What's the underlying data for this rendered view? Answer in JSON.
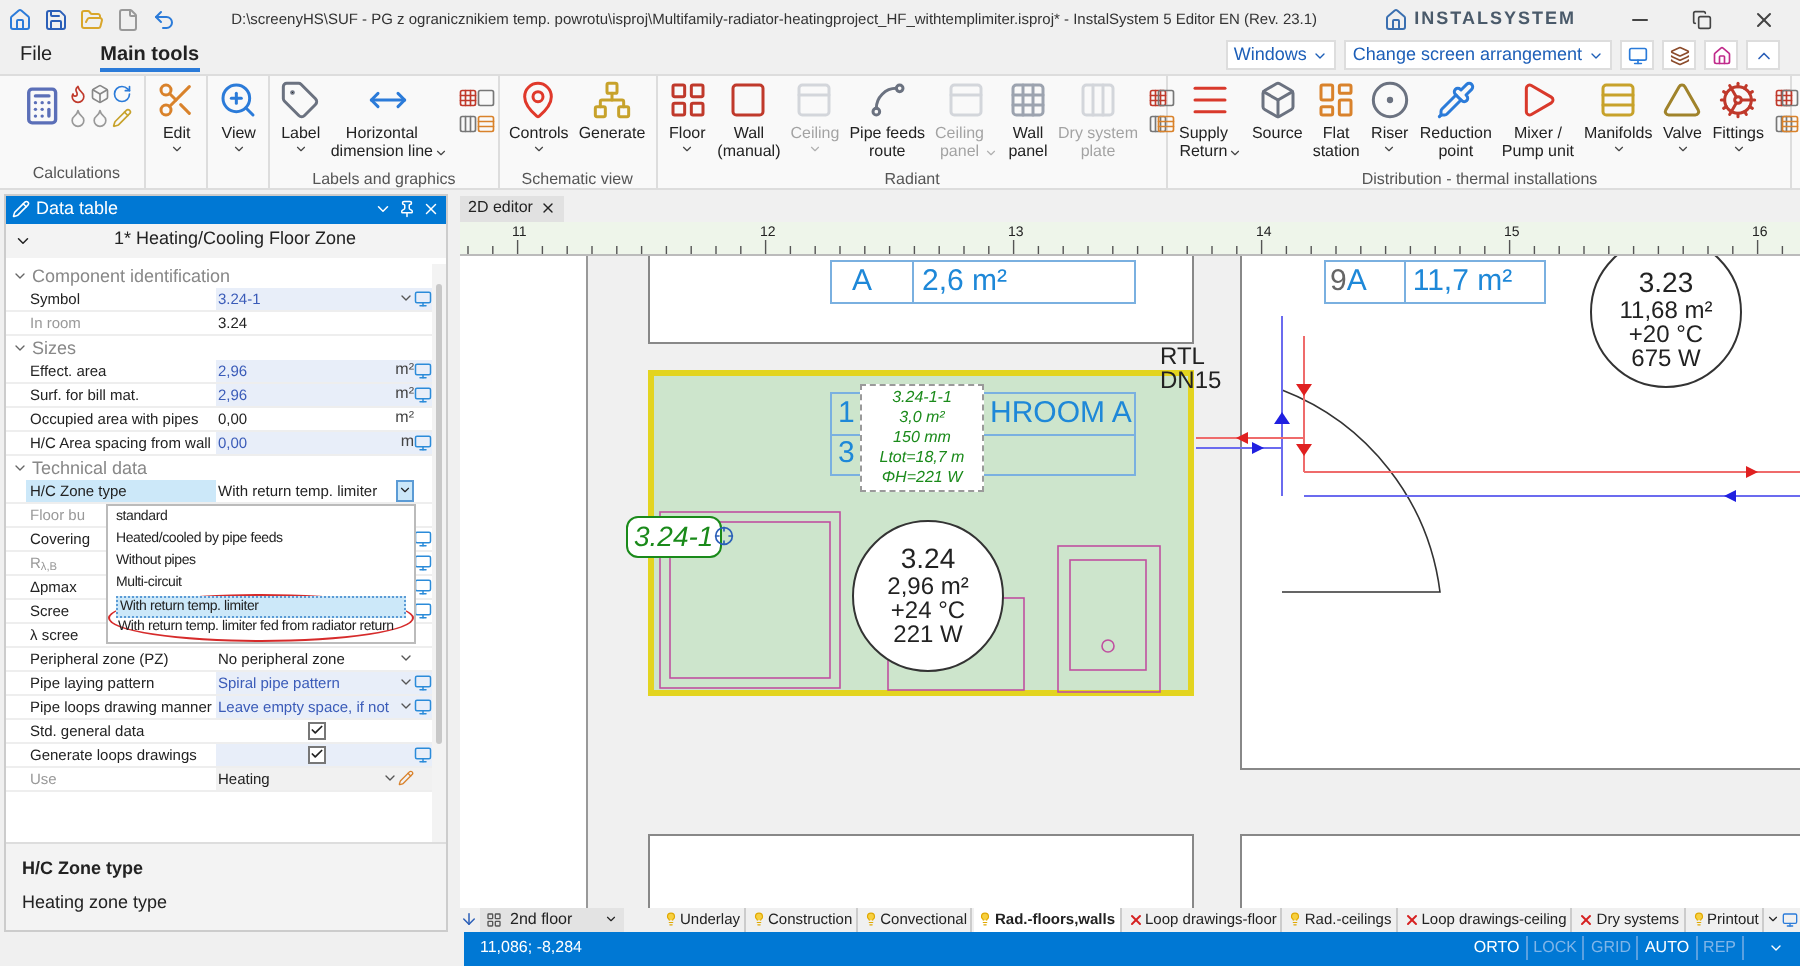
{
  "window": {
    "title": "D:\\screenyHS\\SUF - PG z ogranicznikiem temp. powrotu\\isproj\\Multifamily-radiator-heatingproject_HF_withtemplimiter.isproj* - InstalSystem 5 Editor EN (Rev. 23.1)",
    "logo": "INSTALSYSTEM"
  },
  "menu_tabs": [
    {
      "label": "File",
      "selected": false
    },
    {
      "label": "Main tools",
      "selected": true
    }
  ],
  "top_right": {
    "windows": "Windows",
    "arrangement": "Change screen arrangement"
  },
  "ribbon": [
    {
      "label": "Calculations"
    },
    {
      "buttons": [
        {
          "label": "Edit",
          "dropdown": true,
          "disabled": false
        }
      ]
    },
    {
      "buttons": [
        {
          "label": "View",
          "dropdown": true,
          "disabled": false
        }
      ]
    },
    {
      "label": "Labels and graphics",
      "buttons": [
        {
          "label": "Label",
          "dropdown": true,
          "disabled": false
        },
        {
          "label": "Horizontal\ndimension line",
          "dropdown": true,
          "disabled": false
        }
      ],
      "side_tools": true
    },
    {
      "label": "Schematic view",
      "buttons": [
        {
          "label": "Controls",
          "dropdown": true,
          "disabled": false
        },
        {
          "label": "Generate",
          "dropdown": false,
          "disabled": false
        }
      ]
    },
    {
      "label": "Radiant",
      "buttons": [
        {
          "label": "Floor",
          "dropdown": true,
          "disabled": false
        },
        {
          "label": "Wall\n(manual)",
          "dropdown": false,
          "disabled": false
        },
        {
          "label": "Ceiling",
          "dropdown": true,
          "disabled": true
        },
        {
          "label": "Pipe feeds\nroute",
          "dropdown": false,
          "disabled": false
        },
        {
          "label": "Ceiling\npanel",
          "dropdown": true,
          "disabled": true
        },
        {
          "label": "Wall\npanel",
          "dropdown": false,
          "disabled": false
        },
        {
          "label": "Dry system\nplate",
          "dropdown": false,
          "disabled": true
        }
      ],
      "side_tools": true
    },
    {
      "label": "Distribution - thermal installations",
      "buttons": [
        {
          "label": "Supply\nReturn",
          "dropdown": true,
          "disabled": false
        },
        {
          "label": "Source",
          "dropdown": false,
          "disabled": false
        },
        {
          "label": "Flat\nstation",
          "dropdown": false,
          "disabled": false
        },
        {
          "label": "Riser",
          "dropdown": true,
          "disabled": false
        },
        {
          "label": "Reduction\npoint",
          "dropdown": false,
          "disabled": false
        },
        {
          "label": "Mixer /\nPump unit",
          "dropdown": false,
          "disabled": false
        },
        {
          "label": "Manifolds",
          "dropdown": true,
          "disabled": false
        },
        {
          "label": "Valve",
          "dropdown": true,
          "disabled": false
        },
        {
          "label": "Fittings",
          "dropdown": true,
          "disabled": false
        }
      ],
      "side_tools": true
    }
  ],
  "data_table": {
    "title": "Data table",
    "subject": "1* Heating/Cooling Floor Zone",
    "rows": [
      {
        "kind": "section",
        "label": "Component identification"
      },
      {
        "kind": "property",
        "label": "Symbol",
        "value": "3.24-1",
        "disabled": false,
        "highlighted": true,
        "dropdown": true,
        "link": true,
        "selected": false
      },
      {
        "kind": "property",
        "label": "In room",
        "value": "3.24",
        "disabled": true,
        "highlighted": false,
        "dropdown": false,
        "link": false,
        "selected": false
      },
      {
        "kind": "section",
        "label": "Sizes"
      },
      {
        "kind": "property",
        "label": "Effect. area",
        "value": "2,96",
        "unit": "m²",
        "disabled": false,
        "highlighted": true,
        "dropdown": false,
        "link": true,
        "selected": false
      },
      {
        "kind": "property",
        "label": "Surf. for bill mat.",
        "value": "2,96",
        "unit": "m²",
        "disabled": false,
        "highlighted": true,
        "dropdown": false,
        "link": true,
        "selected": false
      },
      {
        "kind": "property",
        "label": "Occupied area with pipes",
        "value": "0,00",
        "unit": "m²",
        "disabled": false,
        "highlighted": false,
        "dropdown": false,
        "link": false,
        "selected": false
      },
      {
        "kind": "property",
        "label": "H/C Area spacing from wall",
        "value": "0,00",
        "unit": "m",
        "disabled": false,
        "highlighted": true,
        "dropdown": false,
        "link": true,
        "selected": false
      },
      {
        "kind": "section",
        "label": "Technical data"
      },
      {
        "kind": "property",
        "label": "H/C Zone type",
        "value": "With return temp. limiter",
        "disabled": false,
        "highlighted": false,
        "dropdown": true,
        "link": false,
        "selected": true
      },
      {
        "kind": "property",
        "label": "Floor bu",
        "disabled": true,
        "highlighted": false,
        "dropdown": false,
        "link": false,
        "selected": false
      },
      {
        "kind": "property",
        "label": "Covering",
        "disabled": false,
        "highlighted": false,
        "dropdown": false,
        "link": true,
        "selected": false
      },
      {
        "kind": "property",
        "label": "R$_{λ,B}$",
        "disabled": true,
        "highlighted": false,
        "dropdown": false,
        "link": true,
        "selected": false
      },
      {
        "kind": "property",
        "label": "Δpmax",
        "disabled": false,
        "highlighted": false,
        "dropdown": false,
        "link": true,
        "selected": false
      },
      {
        "kind": "property",
        "label": "Scree",
        "disabled": false,
        "highlighted": false,
        "dropdown": false,
        "link": true,
        "selected": false
      },
      {
        "kind": "property",
        "label": "λ scree",
        "disabled": false,
        "highlighted": false,
        "dropdown": false,
        "link": false,
        "selected": false
      },
      {
        "kind": "property",
        "label": "Peripheral zone (PZ)",
        "value": "No peripheral zone",
        "disabled": false,
        "highlighted": false,
        "dropdown": true,
        "link": false,
        "selected": false
      },
      {
        "kind": "property",
        "label": "Pipe laying pattern",
        "value": "Spiral pipe pattern",
        "disabled": false,
        "highlighted": true,
        "dropdown": true,
        "link": true,
        "selected": false
      },
      {
        "kind": "property",
        "label": "Pipe loops drawing manner",
        "value": "Leave empty space, if not",
        "disabled": false,
        "highlighted": true,
        "dropdown": true,
        "link": true,
        "selected": false
      },
      {
        "kind": "check",
        "label": "Std. general data",
        "checked": true,
        "highlighted": false,
        "link": false,
        "selected": false
      },
      {
        "kind": "check",
        "label": "Generate loops drawings",
        "checked": true,
        "highlighted": true,
        "link": true,
        "selected": false
      },
      {
        "kind": "property",
        "label": "Use",
        "value": "Heating",
        "disabled": true,
        "highlighted": false,
        "dropdown": true,
        "link": false,
        "editable": true,
        "selected": false
      }
    ],
    "dropdown": {
      "options": [
        {
          "label": "standard",
          "selected": false,
          "circled": false
        },
        {
          "label": "Heated/cooled by pipe feeds",
          "selected": false,
          "circled": false
        },
        {
          "label": "Without pipes",
          "selected": false,
          "circled": false
        },
        {
          "label": "Multi-circuit",
          "selected": false,
          "circled": false
        },
        {
          "label": "With return temp. limiter",
          "selected": true,
          "circled": true
        },
        {
          "label": "With return temp. limiter fed from radiator return",
          "selected": false,
          "circled": true
        }
      ]
    },
    "description": {
      "title": "H/C Zone type",
      "text": "Heating zone type"
    }
  },
  "editor": {
    "tab": "2D editor",
    "ruler_marks": [
      "11",
      "12",
      "13",
      "14",
      "15",
      "16"
    ],
    "area_tag_top": {
      "col_1": "A",
      "col_2": "2,6 m²"
    },
    "area_tag_right": {
      "prefix": "9",
      "col_1": "A",
      "col_2": "11,7 m²"
    },
    "room_bubbles": [
      {
        "lines": [
          "3.23",
          "11,68 m²",
          "+20 °C",
          "675 W"
        ]
      },
      {
        "lines": [
          "3.24",
          "2,96 m²",
          "+24 °C",
          "221 W"
        ]
      }
    ],
    "valve_label": [
      "RTL",
      "DN15"
    ],
    "room_name_tag": {
      "col_1": "1",
      "col_2": "HROOM A",
      "row_2": "3"
    },
    "loop_label": [
      "3.24-1-1",
      "3,0 m²",
      "150 mm",
      "Ltot=18,7 m",
      "ΦH=221 W"
    ],
    "zone_symbol": "3.24-1",
    "zone_selected": true
  },
  "layers": {
    "floor": "2nd floor",
    "tabs": [
      {
        "label": "Underlay",
        "visible": true,
        "selected": false
      },
      {
        "label": "Construction",
        "visible": true,
        "selected": false
      },
      {
        "label": "Convectional",
        "visible": true,
        "selected": false
      },
      {
        "label": "Rad.-floors,walls",
        "visible": true,
        "selected": true
      },
      {
        "label": "Loop drawings-floor",
        "visible": false,
        "selected": false
      },
      {
        "label": "Rad.-ceilings",
        "visible": true,
        "selected": false
      },
      {
        "label": "Loop drawings-ceiling",
        "visible": false,
        "selected": false
      },
      {
        "label": "Dry systems",
        "visible": false,
        "selected": false
      },
      {
        "label": "Printout",
        "visible": true,
        "selected": false
      }
    ]
  },
  "status_bar": {
    "coords": "11,086; -8,284",
    "toggles": [
      {
        "label": "ORTO",
        "on": true
      },
      {
        "label": "LOCK",
        "on": false
      },
      {
        "label": "GRID",
        "on": false
      },
      {
        "label": "AUTO",
        "on": true
      },
      {
        "label": "REP",
        "on": false
      }
    ]
  }
}
